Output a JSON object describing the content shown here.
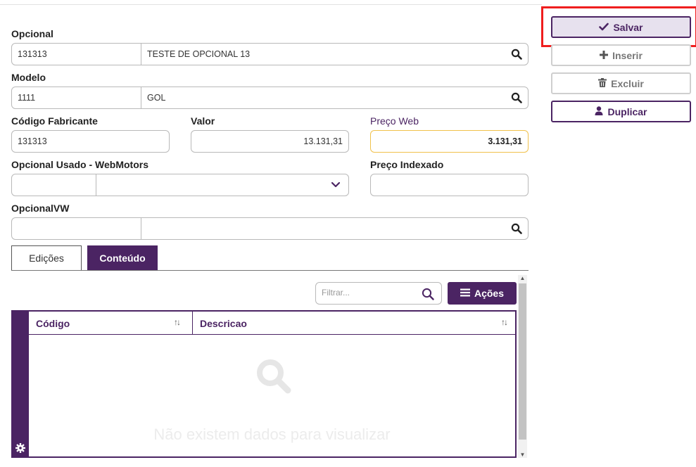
{
  "form": {
    "opcional": {
      "label": "Opcional",
      "code": "131313",
      "description": "TESTE DE OPCIONAL 13"
    },
    "modelo": {
      "label": "Modelo",
      "code": "1111",
      "description": "GOL"
    },
    "codigo_fabricante": {
      "label": "Código Fabricante",
      "value": "131313"
    },
    "valor": {
      "label": "Valor",
      "value": "13.131,31"
    },
    "preco_web": {
      "label": "Preço Web",
      "value": "3.131,31"
    },
    "opcional_usado": {
      "label": "Opcional Usado - WebMotors",
      "code": "",
      "selected": ""
    },
    "preco_indexado": {
      "label": "Preço Indexado",
      "value": ""
    },
    "opcional_vw": {
      "label": "OpcionalVW",
      "code": "",
      "description": ""
    }
  },
  "actions": {
    "salvar": "Salvar",
    "inserir": "Inserir",
    "excluir": "Excluir",
    "duplicar": "Duplicar"
  },
  "tabs": [
    {
      "label": "Edições",
      "active": false
    },
    {
      "label": "Conteúdo",
      "active": true
    }
  ],
  "grid": {
    "filter_placeholder": "Filtrar...",
    "actions_label": "Ações",
    "columns": [
      "Código",
      "Descricao"
    ],
    "empty_message": "Não existem dados para visualizar"
  },
  "colors": {
    "primary": "#4b2463",
    "highlight": "#ef1e1e",
    "price_web_border": "#f0c14b"
  }
}
